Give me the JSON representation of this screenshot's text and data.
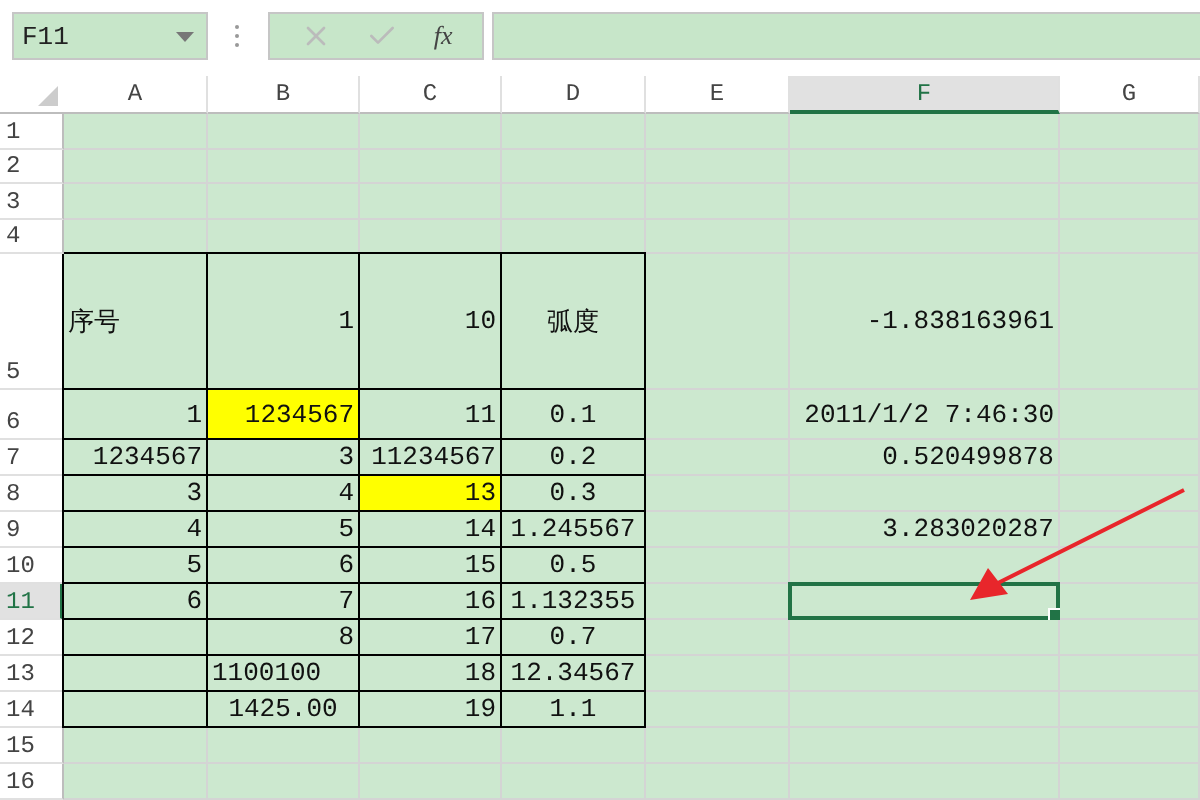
{
  "name_box": {
    "value": "F11"
  },
  "formula_bar": {
    "function_label": "fx"
  },
  "columns": [
    {
      "label": "A",
      "selected": false
    },
    {
      "label": "B",
      "selected": false
    },
    {
      "label": "C",
      "selected": false
    },
    {
      "label": "D",
      "selected": false
    },
    {
      "label": "E",
      "selected": false
    },
    {
      "label": "F",
      "selected": true
    },
    {
      "label": "G",
      "selected": false
    }
  ],
  "rows": [
    {
      "label": "1",
      "selected": false,
      "cells": []
    },
    {
      "label": "2",
      "selected": false,
      "cells": []
    },
    {
      "label": "3",
      "selected": false,
      "cells": []
    },
    {
      "label": "4",
      "selected": false,
      "cells": []
    },
    {
      "label": "5",
      "selected": false,
      "cells": [
        {
          "text": "序号",
          "kind": "text",
          "highlighted": false,
          "bordered": true
        },
        {
          "text": "1",
          "kind": "number",
          "highlighted": false,
          "bordered": true
        },
        {
          "text": "10",
          "kind": "number",
          "highlighted": false,
          "bordered": true
        },
        {
          "text": "弧度",
          "kind": "centered",
          "highlighted": false,
          "bordered": true
        },
        {
          "kind": "blank",
          "highlighted": false,
          "bordered": false
        },
        {
          "text": "-1.838163961",
          "kind": "number",
          "highlighted": false,
          "bordered": false
        },
        {
          "kind": "blank",
          "highlighted": false,
          "bordered": false
        }
      ]
    },
    {
      "label": "6",
      "selected": false,
      "cells": [
        {
          "text": "1",
          "kind": "number",
          "highlighted": false,
          "bordered": true
        },
        {
          "text": "1234567",
          "kind": "number",
          "highlighted": true,
          "bordered": true
        },
        {
          "text": "11",
          "kind": "number",
          "highlighted": false,
          "bordered": true
        },
        {
          "text": "0.1",
          "kind": "centered",
          "highlighted": false,
          "bordered": true
        },
        {
          "kind": "blank",
          "highlighted": false,
          "bordered": false
        },
        {
          "text": "2011/1/2 7:46:30",
          "kind": "number",
          "highlighted": false,
          "bordered": false
        },
        {
          "kind": "blank",
          "highlighted": false,
          "bordered": false
        }
      ]
    },
    {
      "label": "7",
      "selected": false,
      "cells": [
        {
          "text": "1234567",
          "kind": "number",
          "highlighted": false,
          "bordered": true
        },
        {
          "text": "3",
          "kind": "number",
          "highlighted": false,
          "bordered": true
        },
        {
          "text": "11234567",
          "kind": "number",
          "highlighted": false,
          "bordered": true
        },
        {
          "text": "0.2",
          "kind": "centered",
          "highlighted": false,
          "bordered": true
        },
        {
          "kind": "blank",
          "highlighted": false,
          "bordered": false
        },
        {
          "text": "0.520499878",
          "kind": "number",
          "highlighted": false,
          "bordered": false
        },
        {
          "kind": "blank",
          "highlighted": false,
          "bordered": false
        }
      ]
    },
    {
      "label": "8",
      "selected": false,
      "cells": [
        {
          "text": "3",
          "kind": "number",
          "highlighted": false,
          "bordered": true
        },
        {
          "text": "4",
          "kind": "number",
          "highlighted": false,
          "bordered": true
        },
        {
          "text": "13",
          "kind": "number",
          "highlighted": true,
          "bordered": true
        },
        {
          "text": "0.3",
          "kind": "centered",
          "highlighted": false,
          "bordered": true
        },
        {
          "kind": "blank",
          "highlighted": false,
          "bordered": false
        },
        {
          "kind": "blank",
          "highlighted": false,
          "bordered": false
        },
        {
          "kind": "blank",
          "highlighted": false,
          "bordered": false
        }
      ]
    },
    {
      "label": "9",
      "selected": false,
      "cells": [
        {
          "text": "4",
          "kind": "number",
          "highlighted": false,
          "bordered": true
        },
        {
          "text": "5",
          "kind": "number",
          "highlighted": false,
          "bordered": true
        },
        {
          "text": "14",
          "kind": "number",
          "highlighted": false,
          "bordered": true
        },
        {
          "text": "1.245567",
          "kind": "centered",
          "highlighted": false,
          "bordered": true
        },
        {
          "kind": "blank",
          "highlighted": false,
          "bordered": false
        },
        {
          "text": "3.283020287",
          "kind": "number",
          "highlighted": false,
          "bordered": false
        },
        {
          "kind": "blank",
          "highlighted": false,
          "bordered": false
        }
      ]
    },
    {
      "label": "10",
      "selected": false,
      "cells": [
        {
          "text": "5",
          "kind": "number",
          "highlighted": false,
          "bordered": true
        },
        {
          "text": "6",
          "kind": "number",
          "highlighted": false,
          "bordered": true
        },
        {
          "text": "15",
          "kind": "number",
          "highlighted": false,
          "bordered": true
        },
        {
          "text": "0.5",
          "kind": "centered",
          "highlighted": false,
          "bordered": true
        },
        {
          "kind": "blank",
          "highlighted": false,
          "bordered": false
        },
        {
          "kind": "blank",
          "highlighted": false,
          "bordered": false
        },
        {
          "kind": "blank",
          "highlighted": false,
          "bordered": false
        }
      ]
    },
    {
      "label": "11",
      "selected": true,
      "cells": [
        {
          "text": "6",
          "kind": "number",
          "highlighted": false,
          "bordered": true
        },
        {
          "text": "7",
          "kind": "number",
          "highlighted": false,
          "bordered": true
        },
        {
          "text": "16",
          "kind": "number",
          "highlighted": false,
          "bordered": true
        },
        {
          "text": "1.132355",
          "kind": "centered",
          "highlighted": false,
          "bordered": true
        },
        {
          "kind": "blank",
          "highlighted": false,
          "bordered": false
        },
        {
          "kind": "blank",
          "highlighted": false,
          "bordered": false
        },
        {
          "kind": "blank",
          "highlighted": false,
          "bordered": false
        }
      ]
    },
    {
      "label": "12",
      "selected": false,
      "cells": [
        {
          "kind": "blank",
          "highlighted": false,
          "bordered": true
        },
        {
          "text": "8",
          "kind": "number",
          "highlighted": false,
          "bordered": true
        },
        {
          "text": "17",
          "kind": "number",
          "highlighted": false,
          "bordered": true
        },
        {
          "text": "0.7",
          "kind": "centered",
          "highlighted": false,
          "bordered": true
        },
        {
          "kind": "blank",
          "highlighted": false,
          "bordered": false
        },
        {
          "kind": "blank",
          "highlighted": false,
          "bordered": false
        },
        {
          "kind": "blank",
          "highlighted": false,
          "bordered": false
        }
      ]
    },
    {
      "label": "13",
      "selected": false,
      "cells": [
        {
          "kind": "blank",
          "highlighted": false,
          "bordered": true
        },
        {
          "text": "1100100",
          "kind": "text",
          "highlighted": false,
          "bordered": true
        },
        {
          "text": "18",
          "kind": "number",
          "highlighted": false,
          "bordered": true
        },
        {
          "text": "12.34567",
          "kind": "centered",
          "highlighted": false,
          "bordered": true
        },
        {
          "kind": "blank",
          "highlighted": false,
          "bordered": false
        },
        {
          "kind": "blank",
          "highlighted": false,
          "bordered": false
        },
        {
          "kind": "blank",
          "highlighted": false,
          "bordered": false
        }
      ]
    },
    {
      "label": "14",
      "selected": false,
      "cells": [
        {
          "kind": "blank",
          "highlighted": false,
          "bordered": true
        },
        {
          "text": "1425.00",
          "kind": "centered",
          "highlighted": false,
          "bordered": true
        },
        {
          "text": "19",
          "kind": "number",
          "highlighted": false,
          "bordered": true
        },
        {
          "text": "1.1",
          "kind": "centered",
          "highlighted": false,
          "bordered": true
        },
        {
          "kind": "blank",
          "highlighted": false,
          "bordered": false
        },
        {
          "kind": "blank",
          "highlighted": false,
          "bordered": false
        },
        {
          "kind": "blank",
          "highlighted": false,
          "bordered": false
        }
      ]
    },
    {
      "label": "15",
      "selected": false,
      "cells": []
    },
    {
      "label": "16",
      "selected": false,
      "cells": []
    }
  ]
}
